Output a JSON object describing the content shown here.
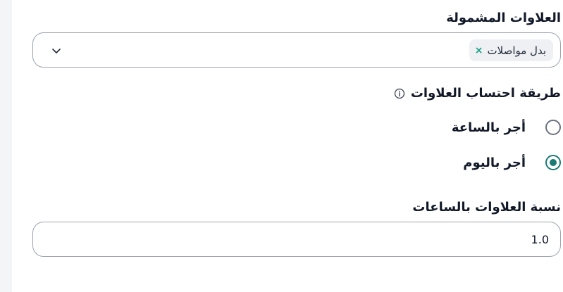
{
  "included_allowances": {
    "label": "العلاوات المشمولة",
    "selected_chips": [
      {
        "label": "بدل مواصلات",
        "remove_glyph": "×"
      }
    ],
    "dropdown_icon": "chevron-down-icon"
  },
  "calculation_method": {
    "label": "طريقة احتساب العلاوات",
    "info_icon": "info-icon",
    "options": [
      {
        "label": "أجر بالساعة",
        "checked": false
      },
      {
        "label": "أجر باليوم",
        "checked": true
      }
    ],
    "accent_color": "#1b7a73"
  },
  "allowance_ratio": {
    "label": "نسبة العلاوات بالساعات",
    "value": "1.0"
  }
}
